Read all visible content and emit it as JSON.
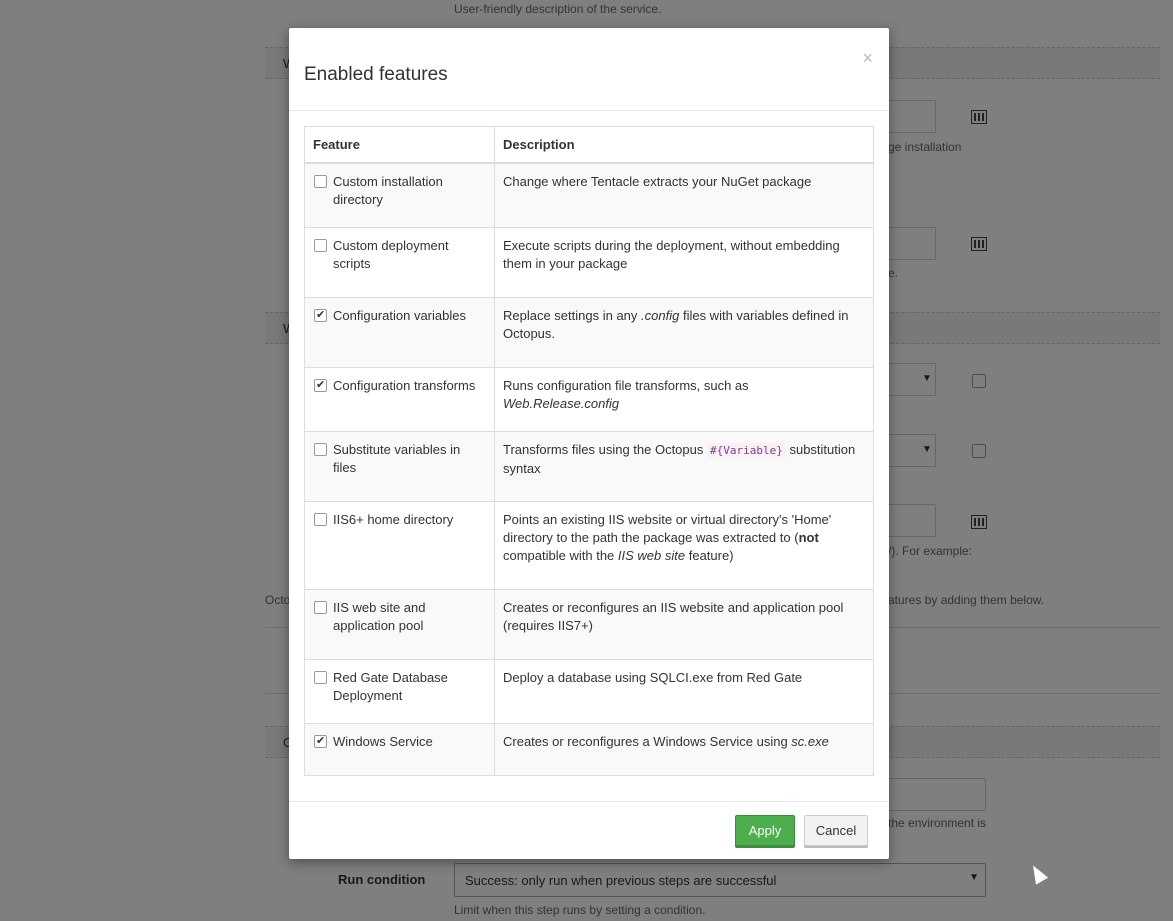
{
  "background": {
    "service_hint": "User-friendly description of the service.",
    "section1_label": "W",
    "section2_label": "W",
    "section3_label": "C",
    "hint_package_install": "ge installation",
    "hint_e": "e.",
    "hint_example": "/). For example:",
    "octopus_prefix": "Octo",
    "hint_features": "atures by adding them below.",
    "hint_environment": "the environment is",
    "run_condition_label": "Run condition",
    "run_condition_value": "Success: only run when previous steps are successful",
    "run_condition_hint": "Limit when this step runs by setting a condition."
  },
  "modal": {
    "title": "Enabled features",
    "close_glyph": "×",
    "columns": {
      "feature": "Feature",
      "description": "Description"
    },
    "features": [
      {
        "name": "Custom installation directory",
        "checked": false,
        "desc": "Change where Tentacle extracts your NuGet package"
      },
      {
        "name": "Custom deployment scripts",
        "checked": false,
        "desc": "Execute scripts during the deployment, without embedding them in your package"
      },
      {
        "name": "Configuration variables",
        "checked": true,
        "desc_pre": "Replace settings in any ",
        "desc_em": ".config",
        "desc_post": " files with variables defined in Octopus."
      },
      {
        "name": "Configuration transforms",
        "checked": true,
        "desc_pre": "Runs configuration file transforms, such as ",
        "desc_em": "Web.Release.config",
        "desc_post": ""
      },
      {
        "name": "Substitute variables in files",
        "checked": false,
        "desc_pre": "Transforms files using the Octopus ",
        "desc_code": "#{Variable}",
        "desc_post": " substitution syntax"
      },
      {
        "name": "IIS6+ home directory",
        "checked": false,
        "desc_pre": "Points an existing IIS website or virtual directory's 'Home' directory to the path the package was extracted to (",
        "desc_strong": "not",
        "desc_mid": " compatible with the ",
        "desc_em": "IIS web site",
        "desc_post": " feature)"
      },
      {
        "name": "IIS web site and application pool",
        "checked": false,
        "desc": "Creates or reconfigures an IIS website and application pool (requires IIS7+)"
      },
      {
        "name": "Red Gate Database Deployment",
        "checked": false,
        "desc": "Deploy a database using SQLCI.exe from Red Gate"
      },
      {
        "name": "Windows Service",
        "checked": true,
        "desc_pre": "Creates or reconfigures a Windows Service using ",
        "desc_em": "sc.exe",
        "desc_post": ""
      }
    ],
    "apply_label": "Apply",
    "cancel_label": "Cancel"
  }
}
